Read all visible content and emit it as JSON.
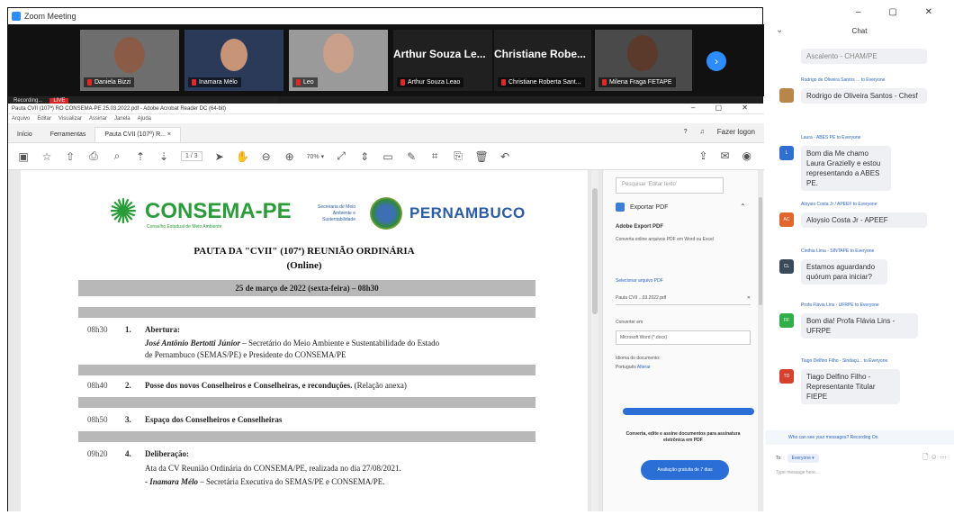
{
  "zoom": {
    "window_title": "Zoom Meeting",
    "participants": [
      {
        "name": "Daniela Bizzi"
      },
      {
        "name": "Inamara Mélo"
      },
      {
        "name": "Leo"
      },
      {
        "name": "Arthur Souza Leao"
      },
      {
        "name": "Christiane Roberta Sant..."
      },
      {
        "name": "Milena Fraga FETAPE"
      }
    ],
    "big_names": [
      "Arthur Souza Le...",
      "Christiane Robe..."
    ],
    "recording_label": "Recording...",
    "live_label": "LIVE",
    "next_icon": "›"
  },
  "acrobat": {
    "title": "Pauta CVII (107ª) RO CONSEMA-PE 25.03.2022.pdf - Adobe Acrobat Reader DC (64-bit)",
    "window_controls": "–  ▢  ✕",
    "menu": [
      "Arquivo",
      "Editar",
      "Visualizar",
      "Assinar",
      "Janela",
      "Ajuda"
    ],
    "tabs": [
      "Início",
      "Ferramentas",
      "Pauta CVII (107ª) R... ×"
    ],
    "signin": "Fazer logon",
    "page_box": "1 / 3",
    "zoom_level": "70% ▾",
    "document": {
      "consema": "CONSEMA-PE",
      "consema_sub": "Conselho Estadual de Meio Ambiente",
      "secretaria": "Secretaria de Meio Ambiente e Sustentabilidade",
      "pernambuco": "PERNAMBUCO",
      "pauta_title": "PAUTA DA \"CVII\" (107ª) REUNIÃO ORDINÁRIA",
      "pauta_sub": "(Online)",
      "date": "25 de março de 2022 (sexta-feira) – 08h30",
      "items": [
        {
          "time": "08h30",
          "num": "1.",
          "head": "Abertura:"
        },
        {
          "time": "08h40",
          "num": "2.",
          "head": "Posse dos novos Conselheiros e Conselheiras, e reconduções.",
          "note": "(Relação anexa)"
        },
        {
          "time": "08h50",
          "num": "3.",
          "head": "Espaço dos Conselheiros e Conselheiras"
        },
        {
          "time": "09h20",
          "num": "4.",
          "head": "Deliberação:"
        }
      ],
      "abertura_line1_bold": "José Antônio Bertotti Júnior",
      "abertura_line1_rest": " – Secretário do Meio Ambiente e Sustentabilidade do Estado",
      "abertura_line2": "de Pernambuco (SEMAS/PE) e Presidente do CONSEMA/PE",
      "delib_line1": "Ata da CV Reunião Ordinária do CONSEMA/PE, realizada no dia 27/08/2021.",
      "delib_line2_bold": "- Inamara Mélo",
      "delib_line2_rest": " – Secretária Executiva do SEMAS/PE e CONSEMA/PE."
    },
    "side_panel": {
      "search_placeholder": "Pesquisar 'Editar texto'",
      "export_label": "Exportar PDF",
      "heading": "Adobe Export PDF",
      "desc": "Converta online arquivos PDF em Word ou Excel",
      "select_link": "Selecionar arquivo PDF",
      "file_name": "Pauta CVII ...03.2022.pdf",
      "convert_label": "Converter em",
      "convert_value": "Microsoft Word (*.docx)",
      "lang_label": "Idioma do documento:",
      "lang_value": "Português",
      "lang_change": "Alterar",
      "promo": "Converta, edite e assine documentos para assinatura eletrônica em PDF",
      "trial": "Avaliação gratuita de 7 dias"
    }
  },
  "chat": {
    "title": "Chat",
    "window_controls": "–  ▢  ✕",
    "messages": [
      {
        "from": "",
        "text": "Ascalento - CHAM/PE",
        "color": "#8a8a8a",
        "initials": ""
      },
      {
        "from": "Rodrigo de Oliveira Santos ... to Everyone",
        "text": "Rodrigo de Oliveira Santos - Chesf",
        "color": "#b8864b",
        "initials": ""
      },
      {
        "from": "Laura - ABES PE to Everyone",
        "text": "Bom dia Me chamo Laura Grazielly e estou representando a ABES PE.",
        "color": "#2f6fd0",
        "initials": "L"
      },
      {
        "from": "Aloysio Costa Jr / APEEF to Everyone",
        "text": "Aloysio Costa Jr - APEEF",
        "color": "#e0662b",
        "initials": "AC"
      },
      {
        "from": "Cinthia Lima - SINTAPE to Everyone",
        "text": "Estamos aguardando quórum para iniciar?",
        "color": "#3a4a5a",
        "initials": "CL"
      },
      {
        "from": "Profa Flávia Lins - UFRPE to Everyone",
        "text": "Bom dia! Profa Flávia Lins - UFRPE",
        "color": "#2fae4a",
        "initials": "FF"
      },
      {
        "from": "Tiago Delfino Filho - Sindaçú... to Everyone",
        "text": "Tiago Delfino Filho - Representante Titular FIEPE",
        "color": "#d6402f",
        "initials": "TD"
      }
    ],
    "who_can_see": "Who can see your messages? Recording On",
    "to_label": "To:",
    "to_value": "Everyone ▾",
    "input_placeholder": "Type message here..."
  }
}
